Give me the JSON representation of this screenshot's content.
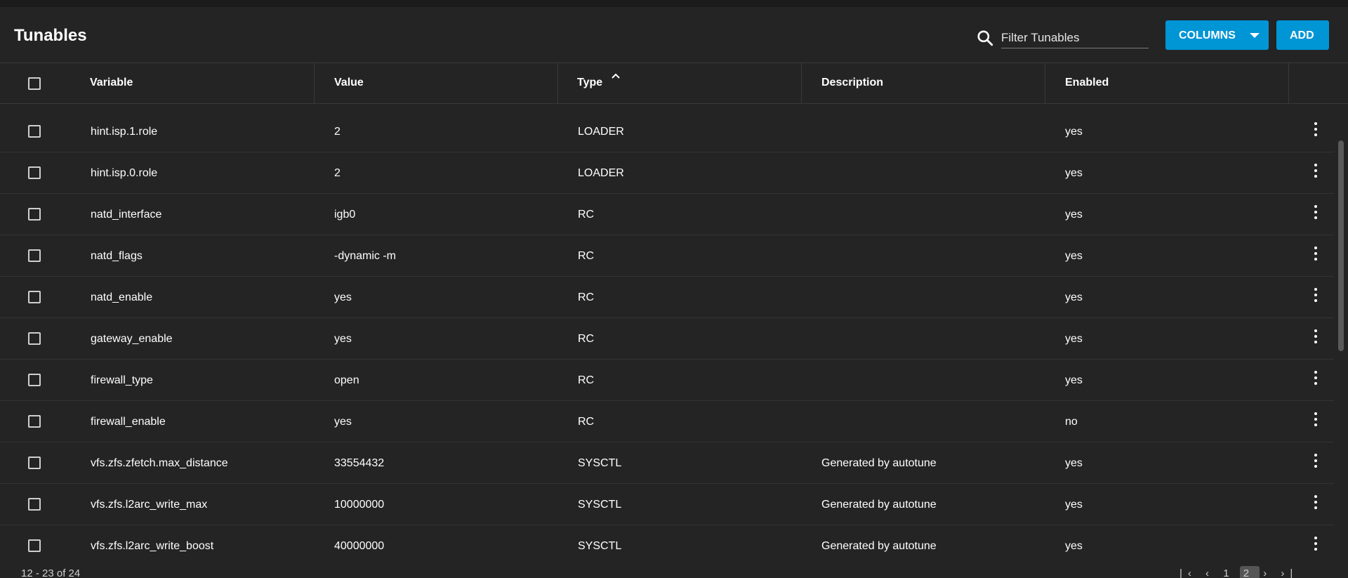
{
  "header": {
    "title": "Tunables",
    "search_placeholder": "Filter Tunables",
    "columns_label": "COLUMNS",
    "add_label": "ADD"
  },
  "columns": [
    "Variable",
    "Value",
    "Type",
    "Description",
    "Enabled"
  ],
  "sort": {
    "column": "Type",
    "direction": "ascending"
  },
  "rows": [
    {
      "variable": "hint.isp.1.role",
      "value": "2",
      "type": "LOADER",
      "description": "",
      "enabled": "yes"
    },
    {
      "variable": "hint.isp.0.role",
      "value": "2",
      "type": "LOADER",
      "description": "",
      "enabled": "yes"
    },
    {
      "variable": "natd_interface",
      "value": "igb0",
      "type": "RC",
      "description": "",
      "enabled": "yes"
    },
    {
      "variable": "natd_flags",
      "value": "-dynamic -m",
      "type": "RC",
      "description": "",
      "enabled": "yes"
    },
    {
      "variable": "natd_enable",
      "value": "yes",
      "type": "RC",
      "description": "",
      "enabled": "yes"
    },
    {
      "variable": "gateway_enable",
      "value": "yes",
      "type": "RC",
      "description": "",
      "enabled": "yes"
    },
    {
      "variable": "firewall_type",
      "value": "open",
      "type": "RC",
      "description": "",
      "enabled": "yes"
    },
    {
      "variable": "firewall_enable",
      "value": "yes",
      "type": "RC",
      "description": "",
      "enabled": "no"
    },
    {
      "variable": "vfs.zfs.zfetch.max_distance",
      "value": "33554432",
      "type": "SYSCTL",
      "description": "Generated by autotune",
      "enabled": "yes"
    },
    {
      "variable": "vfs.zfs.l2arc_write_max",
      "value": "10000000",
      "type": "SYSCTL",
      "description": "Generated by autotune",
      "enabled": "yes"
    },
    {
      "variable": "vfs.zfs.l2arc_write_boost",
      "value": "40000000",
      "type": "SYSCTL",
      "description": "Generated by autotune",
      "enabled": "yes"
    }
  ],
  "footer": {
    "range_text": "12 - 23 of 24",
    "pager_text": "|‹ ‹ 1 2 › ›|",
    "current_page": "2"
  },
  "colors": {
    "background": "#242424",
    "accent": "#0095d5",
    "text": "#ffffff",
    "border": "#3a3a3a"
  }
}
